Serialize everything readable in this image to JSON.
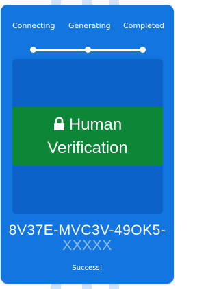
{
  "steps": [
    "Connecting",
    "Generating",
    "Completed"
  ],
  "progress": {
    "completed_steps": 3,
    "total_steps": 3
  },
  "verification": {
    "button_label_line1": "Human",
    "button_label_line2": "Verification",
    "icon": "lock-icon"
  },
  "code": {
    "visible": "8V37E-MVC3V-49OK5-",
    "masked": "XXXXX"
  },
  "status_text": "Success!",
  "colors": {
    "card_background": "#1376e0",
    "panel_background": "#0b63c9",
    "button_background": "#0d8737",
    "text": "#ffffff",
    "masked_text": "#8cbef0"
  }
}
